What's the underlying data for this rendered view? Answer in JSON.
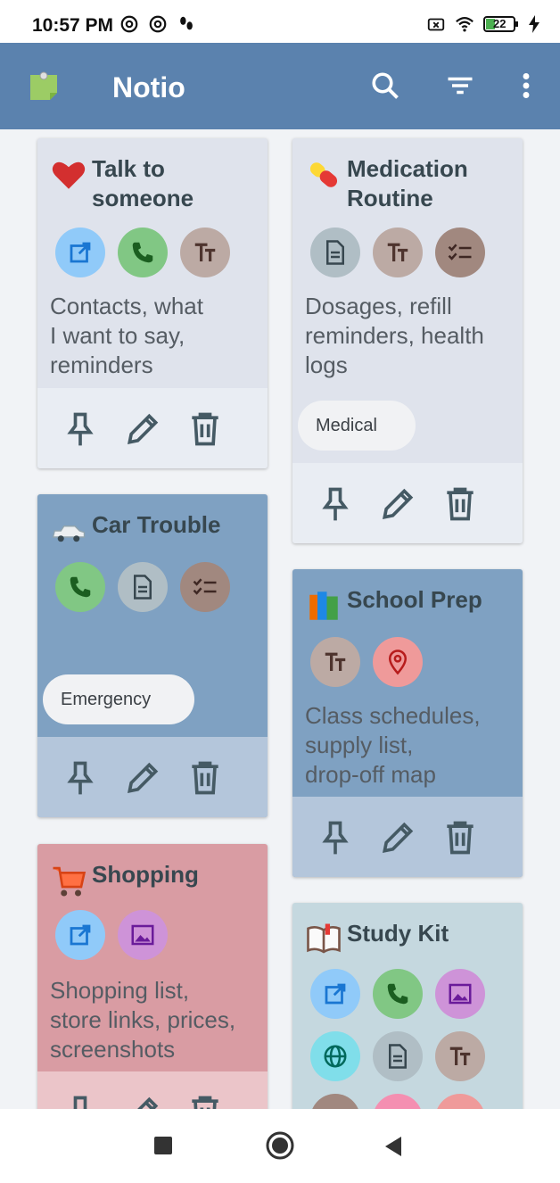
{
  "status": {
    "time": "10:57 PM",
    "battery": "22"
  },
  "app": {
    "title": "Notio"
  },
  "cards": [
    {
      "title_line1": "Talk to",
      "title_line2": "someone",
      "emoji": "heart",
      "icons": [
        "open-link",
        "phone",
        "text"
      ],
      "desc_lines": [
        "Contacts, what",
        "I want to say,",
        "reminders"
      ]
    },
    {
      "title_line1": "Medication",
      "title_line2": "Routine",
      "emoji": "pill",
      "icons": [
        "document",
        "text",
        "checklist"
      ],
      "desc_lines": [
        "Dosages, refill",
        "reminders, health",
        "logs"
      ],
      "tag": "Medical"
    },
    {
      "title_line1": "Car Trouble",
      "emoji": "car",
      "icons": [
        "phone",
        "document",
        "checklist"
      ],
      "tag": "Emergency"
    },
    {
      "title_line1": "School Prep",
      "emoji": "books",
      "icons": [
        "text",
        "location"
      ],
      "desc_lines": [
        "Class schedules,",
        "supply list,",
        "drop-off map"
      ]
    },
    {
      "title_line1": "Shopping",
      "emoji": "cart",
      "icons": [
        "open-link",
        "image"
      ],
      "desc_lines": [
        "Shopping list,",
        "store links, prices,",
        "screenshots"
      ]
    },
    {
      "title_line1": "Study Kit",
      "emoji": "book",
      "icons": [
        "open-link",
        "phone",
        "image",
        "web",
        "document",
        "text"
      ]
    }
  ],
  "colors": {
    "appbar": "#5b82ae",
    "card_gray": "#dfe3ec",
    "card_blue": "#7fa1c2",
    "card_pink": "#d99ca3",
    "card_teal": "#c5d8df"
  }
}
